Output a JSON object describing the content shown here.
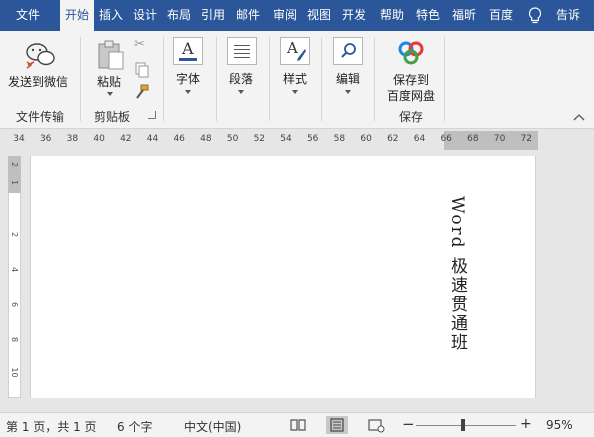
{
  "tabs": [
    "文件",
    "开始",
    "插入",
    "设计",
    "布局",
    "引用",
    "邮件",
    "审阅",
    "视图",
    "开发",
    "帮助",
    "特色",
    "福昕",
    "百度",
    "告诉"
  ],
  "active_tab": "开始",
  "ribbon": {
    "send_wechat": "发送到微信",
    "file_transfer": "文件传输",
    "paste": "粘贴",
    "clipboard": "剪贴板",
    "font": "字体",
    "paragraph": "段落",
    "styles": "样式",
    "editing": "编辑",
    "save_to_line1": "保存到",
    "save_to_line2": "百度网盘",
    "save": "保存"
  },
  "ruler_ticks": [
    "34",
    "36",
    "38",
    "40",
    "42",
    "44",
    "46",
    "48",
    "50",
    "52",
    "54",
    "56",
    "58",
    "60",
    "62",
    "64",
    "66",
    "68",
    "70",
    "72"
  ],
  "vruler_ticks": [
    "2",
    "1",
    "2",
    "4",
    "6",
    "8",
    "10"
  ],
  "document_text": "Word 极速贯通班",
  "status": {
    "page": "第 1 页，共 1 页",
    "words": "6 个字",
    "language": "中文(中国)",
    "zoom_out": "−",
    "zoom_in": "+",
    "zoom": "95%"
  },
  "colors": {
    "accent": "#2b579a",
    "ribbon_bg": "#f3f3f3"
  }
}
